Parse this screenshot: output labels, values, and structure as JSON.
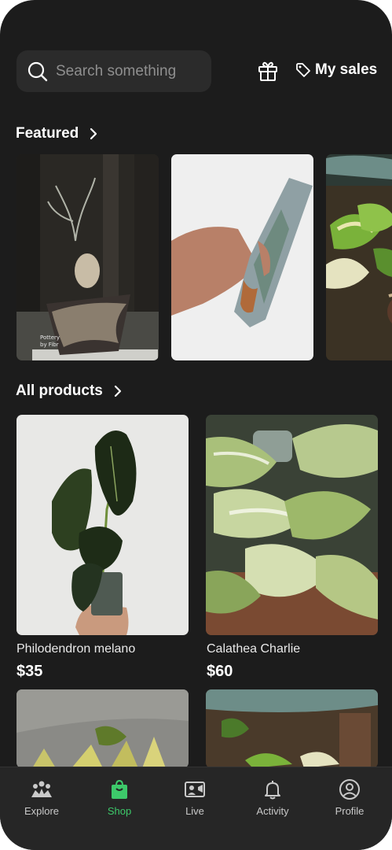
{
  "header": {
    "search_placeholder": "Search something",
    "sales_label": "My sales"
  },
  "featured": {
    "title": "Featured",
    "items": [
      {
        "image": "caudiciform-plant-in-pot-photo",
        "watermark": "Pottery by Fibr"
      },
      {
        "image": "crystal-point-in-hand-photo"
      },
      {
        "image": "variegated-pothos-photo"
      }
    ]
  },
  "products": {
    "title": "All products",
    "items": [
      {
        "name": "Philodendron melano",
        "price": "$35",
        "image": "philodendron-melano-photo"
      },
      {
        "name": "Calathea Charlie",
        "price": "$60",
        "image": "calathea-charlie-photo"
      },
      {
        "image": "yellow-variegated-plant-photo"
      },
      {
        "image": "variegated-plant-shelf-photo"
      }
    ]
  },
  "tabs": [
    {
      "label": "Explore",
      "icon": "explore-icon",
      "active": false
    },
    {
      "label": "Shop",
      "icon": "shopping-bag-icon",
      "active": true
    },
    {
      "label": "Live",
      "icon": "live-video-icon",
      "active": false
    },
    {
      "label": "Activity",
      "icon": "bell-icon",
      "active": false
    },
    {
      "label": "Profile",
      "icon": "profile-icon",
      "active": false
    }
  ],
  "colors": {
    "background": "#1c1c1c",
    "accent": "#3dc96a",
    "tabbar": "#262626"
  }
}
